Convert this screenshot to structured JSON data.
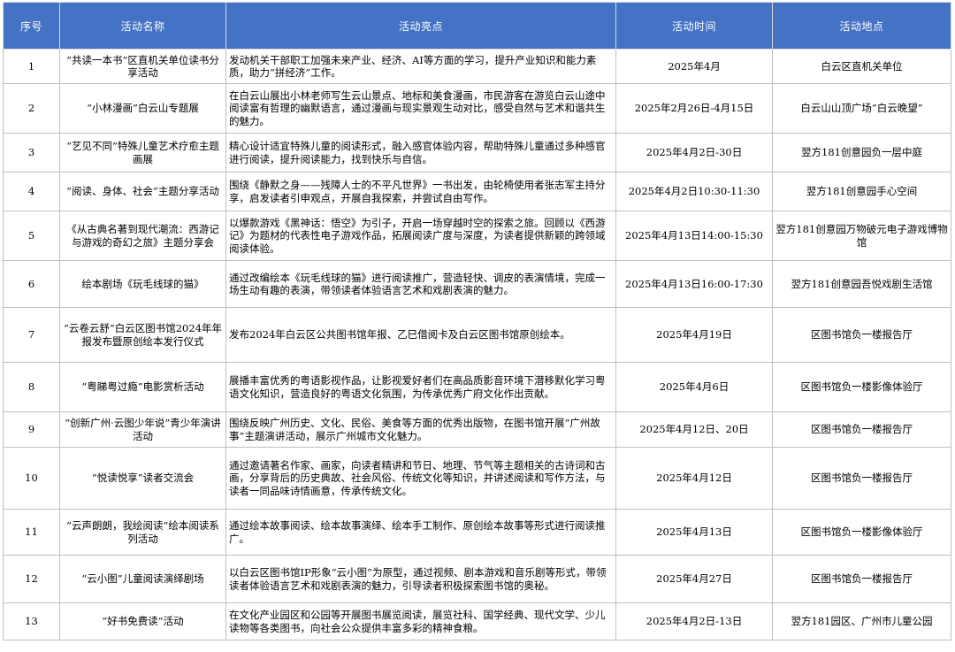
{
  "headers": [
    "序号",
    "活动名称",
    "活动亮点",
    "活动时间",
    "活动地点"
  ],
  "rows": [
    {
      "idx": "1",
      "name": "“共读一本书”区直机关单位读书分享活动",
      "desc": "发动机关干部职工加强未来产业、经济、AI等方面的学习，提升产业知识和能力素质，助力“拼经济”工作。",
      "time": "2025年4月",
      "place": "白云区直机关单位"
    },
    {
      "idx": "2",
      "name": "“小林漫画”白云山专题展",
      "desc": "在白云山展出小林老师写生云山景点、地标和美食漫画，市民游客在游览白云山途中阅读富有哲理的幽默语言，通过漫画与现实景观生动对比，感受自然与艺术和谐共生的魅力。",
      "time": "2025年2月26日-4月15日",
      "place": "白云山山顶广场“白云晚望”"
    },
    {
      "idx": "3",
      "name": "“艺见不同”特殊儿童艺术疗愈主题画展",
      "desc": "精心设计适宜特殊儿童的阅读形式，融入感官体验内容，帮助特殊儿童通过多种感官进行阅读，提升阅读能力，找到快乐与自信。",
      "time": "2025年4月2日-30日",
      "place": "翌方181创意园负一层中庭"
    },
    {
      "idx": "4",
      "name": "“阅读、身体、社会”主题分享活动",
      "desc": "围绕《静默之身——残障人士的不平凡世界》一书出发，由轮椅使用者张志军主持分享，启发读者引申观点，开展自我探索，并尝试自由写作。",
      "time": "2025年4月2日10:30-11:30",
      "place": "翌方181创意园手心空间"
    },
    {
      "idx": "5",
      "name": "《从古典名著到现代潮流：西游记与游戏的奇幻之旅》主题分享会",
      "desc": "以爆款游戏《黑神话：悟空》为引子，开启一场穿越时空的探索之旅。回顾以《西游记》为题材的代表性电子游戏作品，拓展阅读广度与深度，为读者提供新颖的跨领域阅读体验。",
      "time": "2025年4月13日14:00-15:30",
      "place": "翌方181创意园万物破元电子游戏博物馆"
    },
    {
      "idx": "6",
      "name": "绘本剧场《玩毛线球的猫》",
      "desc": "通过改编绘本《玩毛线球的猫》进行阅读推广，营造轻快、调皮的表演情境，完成一场生动有趣的表演，带领读者体验语言艺术和戏剧表演的魅力。",
      "time": "2025年4月13日16:00-17:30",
      "place": "翌方181创意园吾悦戏剧生活馆"
    },
    {
      "idx": "7",
      "name": "“云卷云舒”白云区图书馆2024年年报发布暨原创绘本发行仪式",
      "desc": "发布2024年白云区公共图书馆年报、乙巳借阅卡及白云区图书馆原创绘本。",
      "time": "2025年4月19日",
      "place": "区图书馆负一楼报告厅"
    },
    {
      "idx": "8",
      "name": "“粤睇粤过瘾”电影赏析活动",
      "desc": "展播丰富优秀的粤语影视作品，让影视爱好者们在高品质影音环境下潜移默化学习粤语文化知识，营造良好的粤语文化氛围，为传承优秀广府文化作出贡献。",
      "time": "2025年4月6日",
      "place": "区图书馆负一楼影像体验厅"
    },
    {
      "idx": "9",
      "name": "“创新广州·云图少年说”青少年演讲活动",
      "desc": "围绕反映广州历史、文化、民俗、美食等方面的优秀出版物，在图书馆开展“广州故事”主题演讲活动，展示广州城市文化魅力。",
      "time": "2025年4月12日、20日",
      "place": "区图书馆负一楼报告厅"
    },
    {
      "idx": "10",
      "name": "“悦读悦享”读者交流会",
      "desc": "通过邀请著名作家、画家，向读者精讲和节日、地理、节气等主题相关的古诗词和古画，分享背后的历史典故、社会风俗、传统文化等知识，并讲述阅读和写作方法，与读者一同品味诗情画意，传承传统文化。",
      "time": "2025年4月12日",
      "place": "区图书馆负一楼报告厅"
    },
    {
      "idx": "11",
      "name": "“云声朗朗，我绘阅读”绘本阅读系列活动",
      "desc": "通过绘本故事阅读、绘本故事演绎、绘本手工制作、原创绘本故事等形式进行阅读推广。",
      "time": "2025年4月13日",
      "place": "区图书馆负一楼影像体验厅"
    },
    {
      "idx": "12",
      "name": "“云小图”儿童阅读演绎剧场",
      "desc": "以白云区图书馆IP形象“云小图”为原型，通过视频、剧本游戏和音乐剧等形式，带领读者体验语言艺术和戏剧表演的魅力，引导读者积极探索图书馆的奥秘。",
      "time": "2025年4月27日",
      "place": "区图书馆负一楼报告厅"
    },
    {
      "idx": "13",
      "name": "“好书免费读”活动",
      "desc": "在文化产业园区和公园等开展图书展览阅读，展览社科、国学经典、现代文学、少儿读物等各类图书，向社会公众提供丰富多彩的精神食粮。",
      "time": "2025年4月2日-13日",
      "place": "翌方181园区、广州市儿童公园"
    }
  ]
}
